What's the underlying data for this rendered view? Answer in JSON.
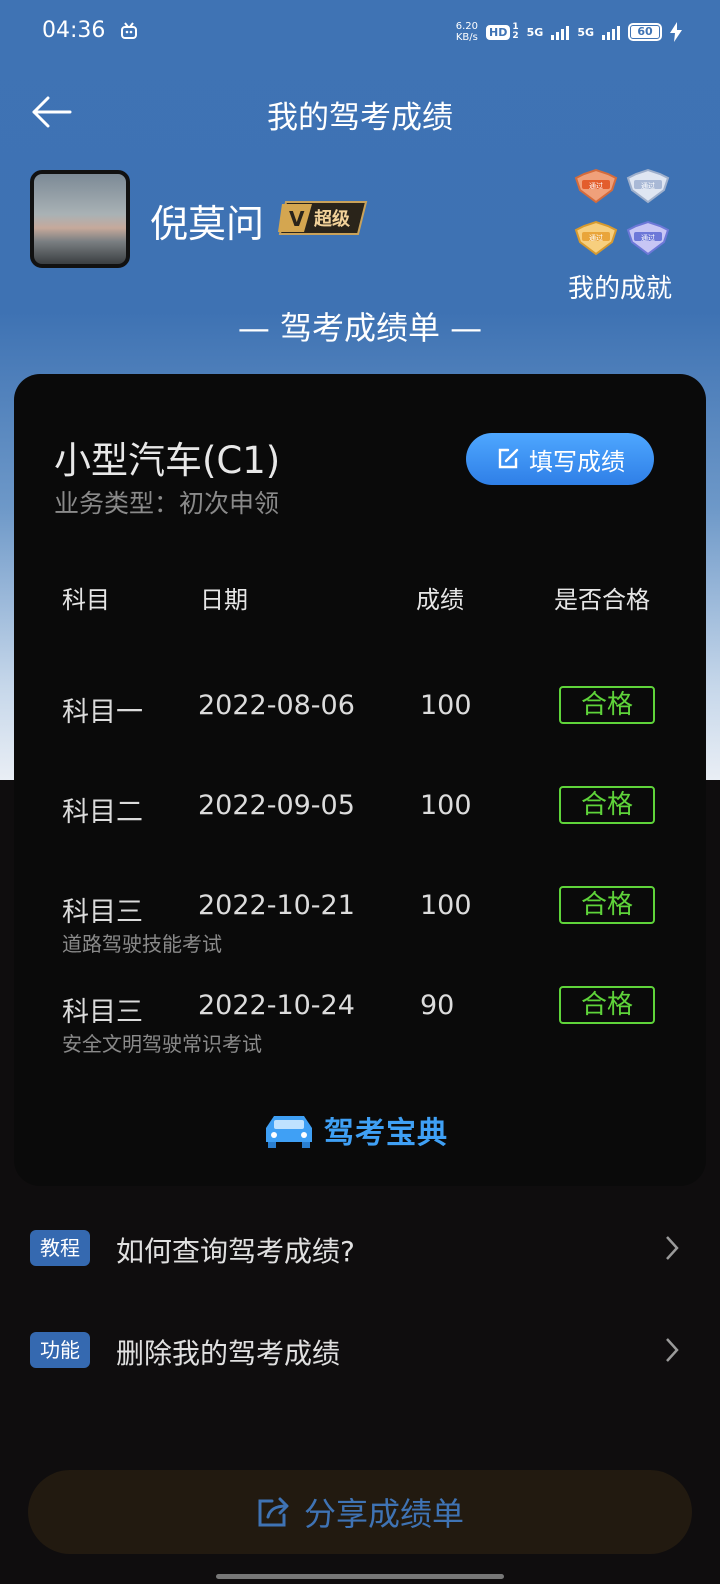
{
  "status_bar": {
    "time": "04:36",
    "speed_value": "6.20",
    "speed_unit": "KB/s",
    "hd": "HD",
    "hd_sup": "1",
    "hd_sub": "2",
    "net1": "5G",
    "net2": "5G",
    "battery": "60",
    "icons": [
      "bilibili-notify-icon",
      "signal-icon",
      "battery-icon",
      "charging-icon"
    ]
  },
  "header": {
    "title": "我的驾考成绩"
  },
  "profile": {
    "username": "倪莫问",
    "vip_label": "超级",
    "achievements_label": "我的成就",
    "medal_label": "通过"
  },
  "section_title": "— 驾考成绩单 —",
  "card": {
    "vehicle": "小型汽车(C1)",
    "business_type": "业务类型：初次申领",
    "fill_button": "填写成绩",
    "columns": [
      "科目",
      "日期",
      "成绩",
      "是否合格"
    ],
    "rows": [
      {
        "subject": "科目一",
        "date": "2022-08-06",
        "score": "100",
        "result": "合格",
        "note": ""
      },
      {
        "subject": "科目二",
        "date": "2022-09-05",
        "score": "100",
        "result": "合格",
        "note": ""
      },
      {
        "subject": "科目三",
        "date": "2022-10-21",
        "score": "100",
        "result": "合格",
        "note": "道路驾驶技能考试"
      },
      {
        "subject": "科目三",
        "date": "2022-10-24",
        "score": "90",
        "result": "合格",
        "note": "安全文明驾驶常识考试"
      }
    ],
    "brand": "驾考宝典"
  },
  "links": [
    {
      "tag": "教程",
      "text": "如何查询驾考成绩?"
    },
    {
      "tag": "功能",
      "text": "删除我的驾考成绩"
    }
  ],
  "share_button": "分享成绩单",
  "colors": {
    "header_blue": "#3f73b4",
    "pass_green": "#5fd43a",
    "button_blue": "#3a8ff0",
    "tag_blue": "#3569b0"
  }
}
